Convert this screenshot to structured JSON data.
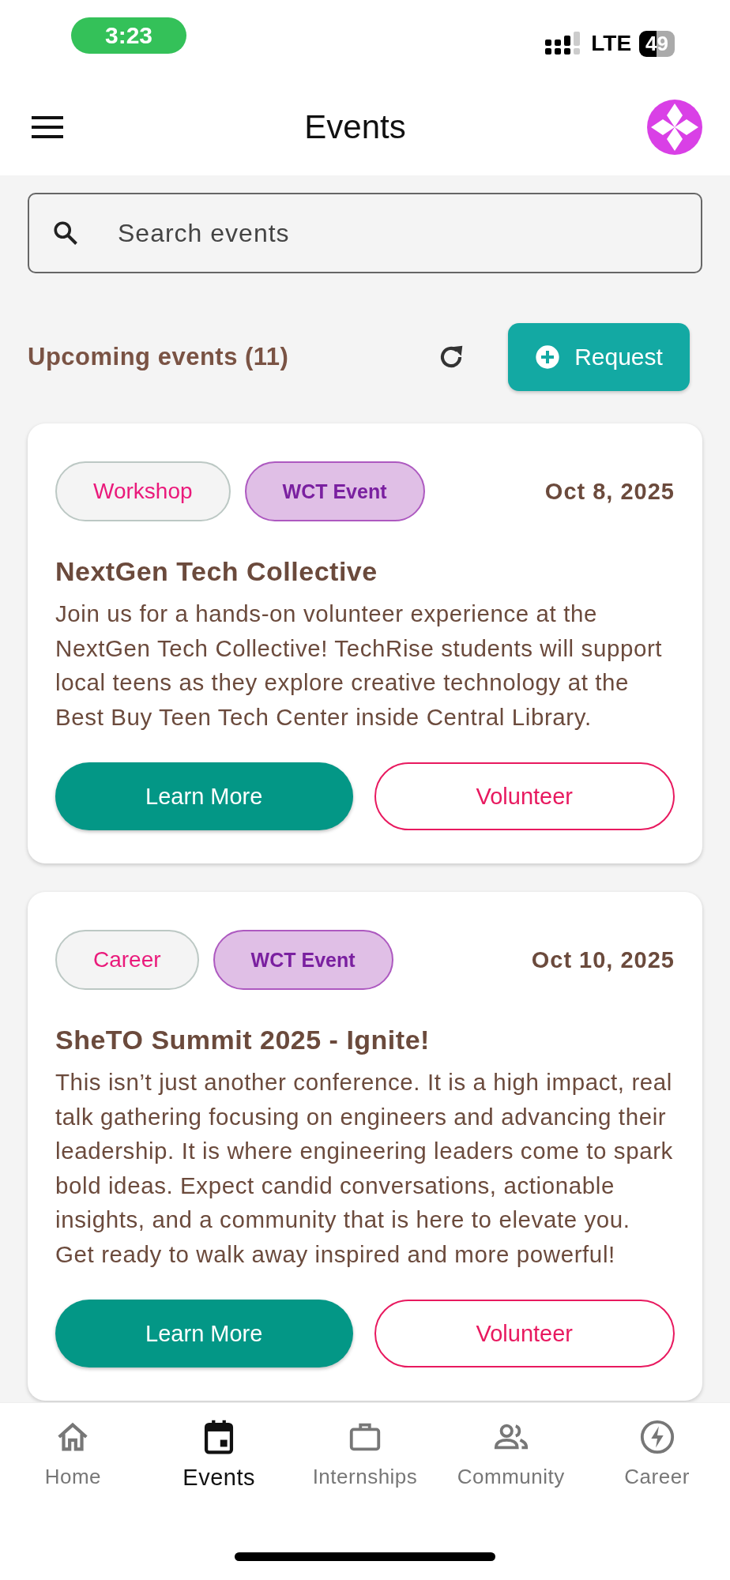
{
  "status_bar": {
    "time": "3:23",
    "network": "LTE",
    "battery": "49"
  },
  "header": {
    "title": "Events"
  },
  "search": {
    "placeholder": "Search events"
  },
  "section": {
    "title": "Upcoming events (11)",
    "request_button": "Request"
  },
  "events": [
    {
      "tags": [
        {
          "label": "Workshop",
          "kind": "category"
        },
        {
          "label": "WCT Event",
          "kind": "wct"
        }
      ],
      "date": "Oct 8, 2025",
      "title": "NextGen Tech Collective",
      "description": "Join us for a hands-on volunteer experience at the NextGen Tech Collective! TechRise students will support local teens as they explore creative technology at the Best Buy Teen Tech Center inside Central Library.",
      "buttons": [
        {
          "label": "Learn More",
          "kind": "primary"
        },
        {
          "label": "Volunteer",
          "kind": "outline"
        }
      ]
    },
    {
      "tags": [
        {
          "label": "Career",
          "kind": "category"
        },
        {
          "label": "WCT Event",
          "kind": "wct"
        }
      ],
      "date": "Oct 10, 2025",
      "title": "SheTO Summit 2025 - Ignite!",
      "description": "This isn’t just another conference. It is a high impact, real talk gathering focusing on engineers and advancing their leadership. It is where engineering leaders come to spark bold ideas. Expect candid conversations, actionable insights, and a community that is here to elevate you. Get ready to walk away inspired and more powerful!",
      "buttons": [
        {
          "label": "Learn More",
          "kind": "primary"
        },
        {
          "label": "Volunteer",
          "kind": "outline"
        }
      ]
    }
  ],
  "nav": [
    {
      "label": "Home",
      "selected": false
    },
    {
      "label": "Events",
      "selected": true
    },
    {
      "label": "Internships",
      "selected": false
    },
    {
      "label": "Community",
      "selected": false
    },
    {
      "label": "Career",
      "selected": false
    }
  ]
}
